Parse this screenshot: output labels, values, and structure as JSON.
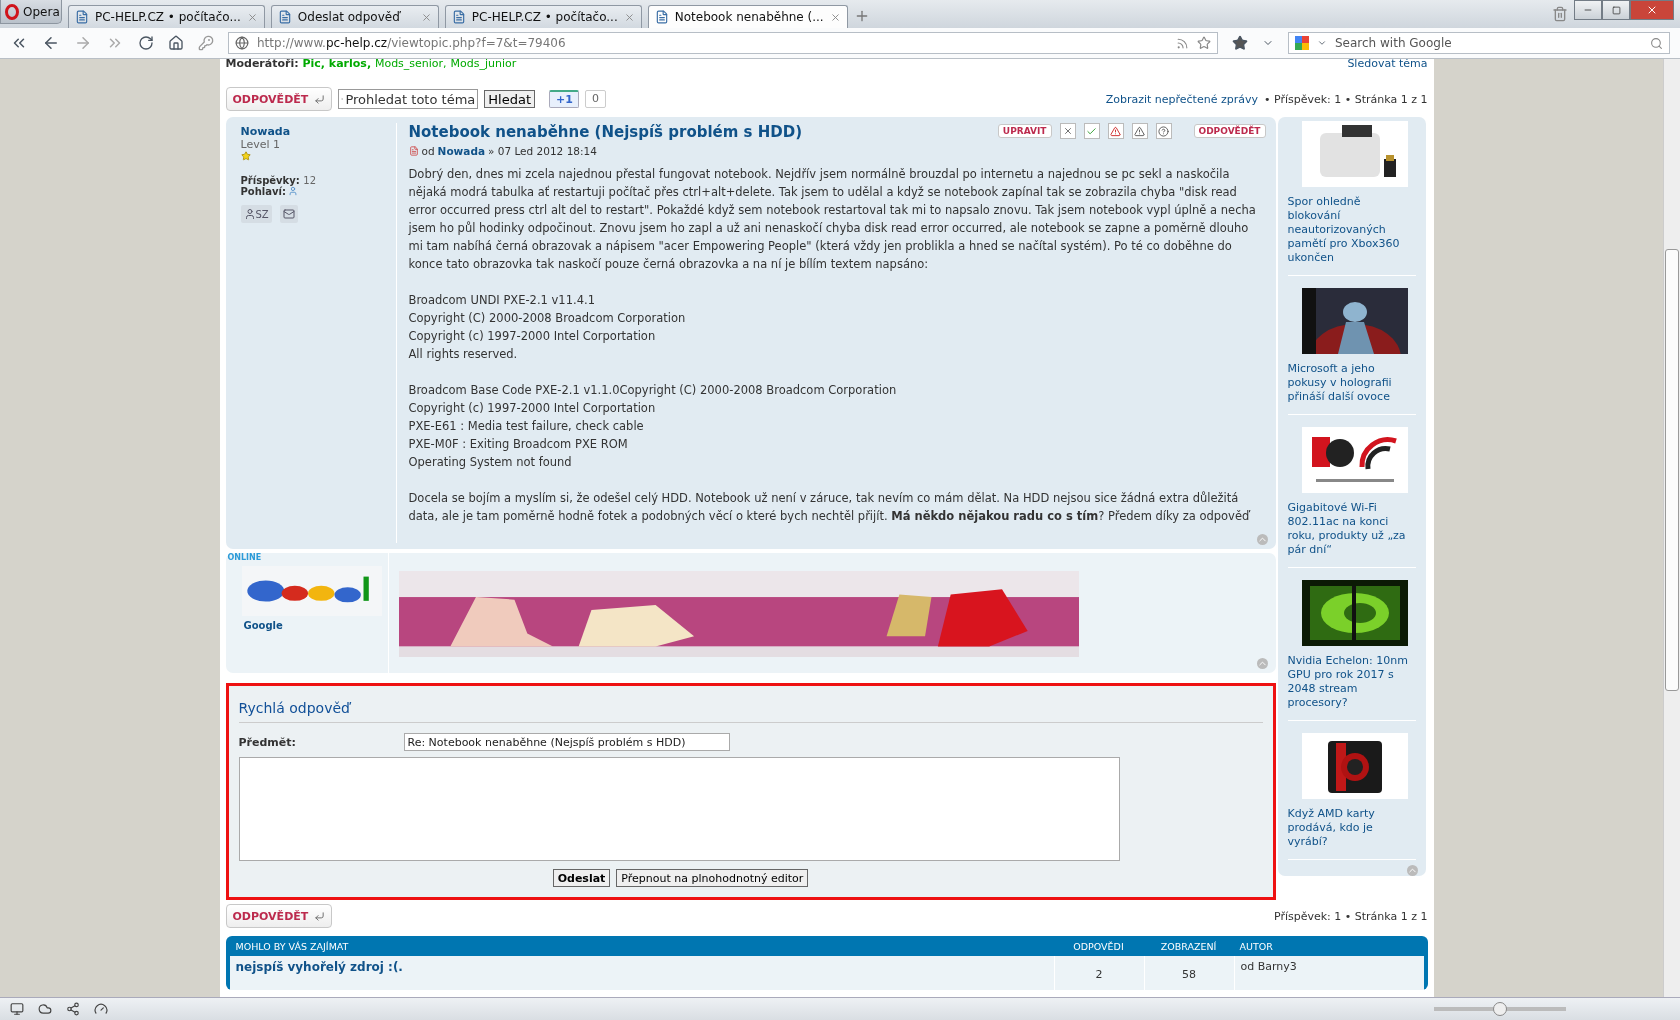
{
  "browser": {
    "menu_label": "Opera",
    "tabs": [
      {
        "title": "PC-HELP.CZ • počítačo...",
        "selected": false
      },
      {
        "title": "Odeslat odpověď",
        "selected": false
      },
      {
        "title": "PC-HELP.CZ • počítačo...",
        "selected": false
      },
      {
        "title": "Notebook nenaběhne (...",
        "selected": true
      }
    ],
    "url_prefix": "http://www.",
    "url_host": "pc-help.cz",
    "url_path": "/viewtopic.php?f=7&t=79406",
    "search_placeholder": "Search with Google"
  },
  "topic": {
    "moderators_label": "Moderátoři:",
    "moderators": [
      {
        "name": "Pic,",
        "kind": "bold"
      },
      {
        "name": "karlos,",
        "kind": "bold"
      },
      {
        "name": "Mods_senior,",
        "kind": "normal"
      },
      {
        "name": "Mods_junior",
        "kind": "normal"
      }
    ],
    "watch_link": "Sledovat téma"
  },
  "toolbar": {
    "reply_button": "ODPOVĚDĚT",
    "search_placeholder": "Prohledat toto téma",
    "search_button": "Hledat",
    "plus_one": "+1",
    "plus_count": "0",
    "unread_link": "Zobrazit nepřečtené zprávy",
    "pagination": "• Příspěvek: 1 • Stránka 1 z 1"
  },
  "post": {
    "author": "Nowada",
    "rank": "Level 1",
    "posts_label": "Příspěvky:",
    "posts_count": "12",
    "gender_label": "Pohlaví:",
    "profile_button_label": "SZ",
    "title": "Notebook nenaběhne (Nejspíš problém s HDD)",
    "by": "od",
    "by_author": "Nowada",
    "date": "» 07 Led 2012 18:14",
    "edit_button": "UPRAVIT",
    "reply_button": "ODPOVĚDĚT",
    "body": [
      {
        "kind": "para",
        "text": "Dobrý den, dnes mi zcela najednou přestal fungovat notebook. Nejdřív jsem normálně brouzdal po internetu a najednou se pc sekl a naskočila nějaká modrá tabulka ať restartuji počítač přes ctrl+alt+delete. Tak jsem to udělal a když se notebook zapínal tak se zobrazila chyba \"disk read error occurred press ctrl alt del to restart\". Pokaždé když sem notebook restartoval tak mi to napsalo znovu. Tak jsem notebook vypl úplně a necha jsem ho půl hodinky odpočinout. Znovu jsem ho zapl a už ani nenaskočí chyba disk read error occurred, ale notebook se zapne a poměrně dlouho mi tam nabíhá černá obrazovak a nápisem \"acer Empowering People\" (která vždy jen problikla a hned se načítal systém). Po té co doběhne do konce tato obrazovka tak naskočí pouze černá obrazovka a na ní je bílím textem napsáno:"
      },
      {
        "kind": "lines",
        "lines": [
          "Broadcom UNDI PXE-2.1 v11.4.1",
          "Copyright (C) 2000-2008 Broadcom Corporation",
          "Copyright (c) 1997-2000 Intel Corportation",
          "All rights reserved."
        ]
      },
      {
        "kind": "lines",
        "lines": [
          "Broadcom Base Code PXE-2.1 v1.1.0Copyright (C) 2000-2008 Broadcom Corporation",
          "Copyright (c) 1997-2000 Intel Corportation",
          "PXE-E61 : Media test failure, check cable",
          "PXE-M0F : Exiting Broadcom PXE ROM",
          "Operating System not found"
        ]
      },
      {
        "kind": "para",
        "text": "Docela se bojím a myslím si, že odešel celý HDD. Notebook už není v záruce, tak nevím co mám dělat. Na HDD nejsou sice žádná extra důležitá data, ale je tam poměrně hodně fotek a podobných věcí o které bych nechtěl přijít. **Má někdo nějakou radu co s tím**? Předem díky za odpověď"
      }
    ]
  },
  "ad_post": {
    "status": "ONLINE",
    "author": "Google"
  },
  "sidebar": {
    "items": [
      {
        "title": "Spor ohledně blokování neautorizovaných pamětí pro Xbox360 ukončen"
      },
      {
        "title": "Microsoft a jeho pokusy v holografii přináší další ovoce"
      },
      {
        "title": "Gigabitové Wi-Fi 802.11ac na konci roku, produkty už „za pár dní“"
      },
      {
        "title": "Nvidia Echelon: 10nm GPU pro rok 2017 s 2048 stream procesory?"
      },
      {
        "title": "Když AMD karty prodává, kdo je vyrábí?"
      }
    ]
  },
  "quick_reply": {
    "title": "Rychlá odpověď",
    "subject_label": "Předmět:",
    "subject_value": "Re: Notebook nenaběhne (Nejspíš problém s HDD)",
    "submit_button": "Odeslat",
    "full_editor_button": "Přepnout na plnohodnotný editor"
  },
  "bottom": {
    "reply_button": "ODPOVĚDĚT",
    "pagination": "Příspěvek: 1 • Stránka 1 z 1"
  },
  "related": {
    "columns": [
      "MOHLO BY VÁS ZAJÍMAT",
      "ODPOVĚDI",
      "ZOBRAZENÍ",
      "AUTOR"
    ],
    "rows": [
      {
        "title": "nejspíš vyhořelý zdroj :(.",
        "replies": "2",
        "views": "58",
        "author": "od Barny3"
      }
    ]
  },
  "status_bar": {
    "zoom": {
      "level": 0.5
    }
  }
}
